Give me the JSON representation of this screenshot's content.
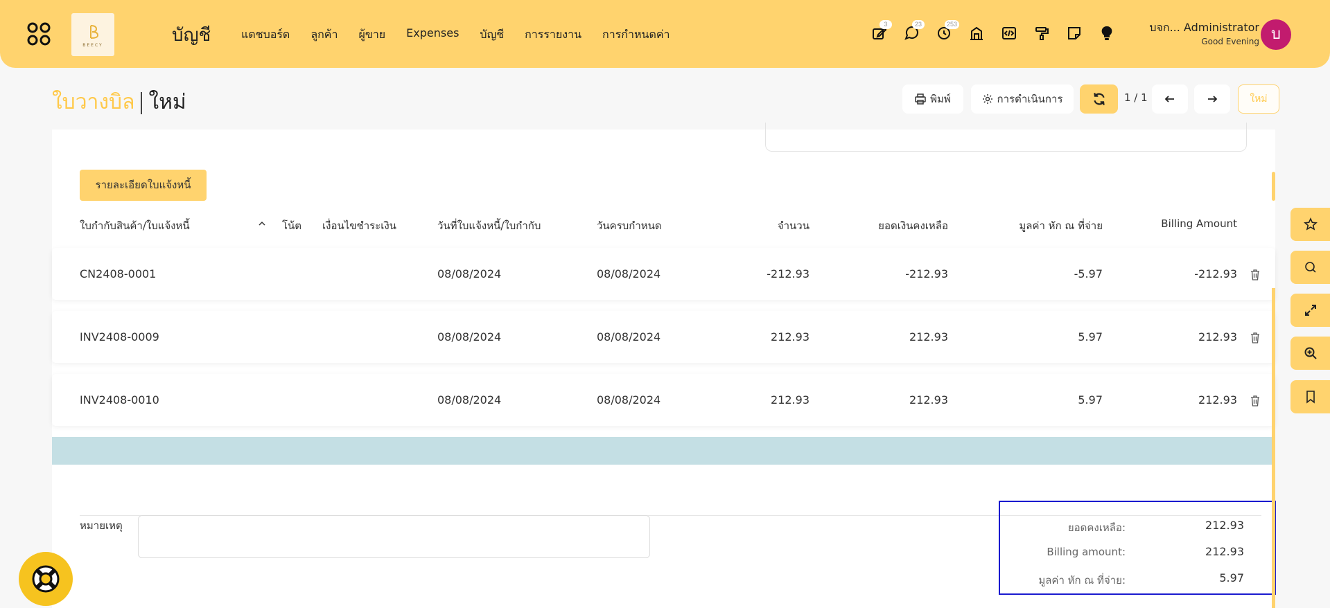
{
  "app": {
    "title": "บัญชี",
    "logo_text": "BEECY"
  },
  "nav": [
    "แดชบอร์ด",
    "ลูกค้า",
    "ผู้ขาย",
    "Expenses",
    "บัญชี",
    "การรายงาน",
    "การกำหนดค่า"
  ],
  "toolbar_icons": [
    {
      "icon": "edit-icon",
      "badge": "3"
    },
    {
      "icon": "chat-icon",
      "badge": "23"
    },
    {
      "icon": "clock-icon",
      "badge": "253"
    },
    {
      "icon": "building-icon",
      "badge": ""
    },
    {
      "icon": "code-icon",
      "badge": ""
    },
    {
      "icon": "paint-roller-icon",
      "badge": ""
    },
    {
      "icon": "sticky-note-icon",
      "badge": ""
    },
    {
      "icon": "lightbulb-icon",
      "badge": ""
    }
  ],
  "user": {
    "name": "บจก... Administrator",
    "greeting": "Good Evening",
    "avatar_letter": "บ"
  },
  "page": {
    "breadcrumb_parent": "ใบวางบิล",
    "breadcrumb_current": "ใหม่",
    "print_label": "พิมพ์",
    "actions_label": "การดำเนินการ",
    "pager": "1 / 1",
    "new_label": "ใหม่"
  },
  "section_button": "รายละเอียดใบแจ้งหนี้",
  "table": {
    "headers": [
      "ใบกำกับสินค้า/ใบแจ้งหนี้",
      "โน้ต",
      "เงื่อนไขชำระเงิน",
      "วันที่ใบแจ้งหนี้/ใบกำกับ",
      "วันครบกำหนด",
      "จำนวน",
      "ยอดเงินคงเหลือ",
      "มูลค่า หัก ณ ที่จ่าย",
      "Billing Amount"
    ],
    "rows": [
      {
        "doc": "CN2408-0001",
        "note": "",
        "terms": "",
        "invoice_date": "08/08/2024",
        "due_date": "08/08/2024",
        "amount": "-212.93",
        "balance": "-212.93",
        "withholding": "-5.97",
        "billing": "-212.93"
      },
      {
        "doc": "INV2408-0009",
        "note": "",
        "terms": "",
        "invoice_date": "08/08/2024",
        "due_date": "08/08/2024",
        "amount": "212.93",
        "balance": "212.93",
        "withholding": "5.97",
        "billing": "212.93"
      },
      {
        "doc": "INV2408-0010",
        "note": "",
        "terms": "",
        "invoice_date": "08/08/2024",
        "due_date": "08/08/2024",
        "amount": "212.93",
        "balance": "212.93",
        "withholding": "5.97",
        "billing": "212.93"
      }
    ]
  },
  "notes": {
    "label": "หมายเหตุ",
    "value": ""
  },
  "totals": [
    {
      "label": "ยอดคงเหลือ:",
      "value": "212.93"
    },
    {
      "label": "Billing amount:",
      "value": "212.93"
    },
    {
      "label": "มูลค่า หัก ณ ที่จ่าย:",
      "value": "5.97"
    }
  ],
  "side_tools": [
    "star-icon",
    "search-icon",
    "expand-icon",
    "zoom-in-icon",
    "bookmark-icon"
  ],
  "colors": {
    "accent": "#ffd36e",
    "crumb": "#ffc94a",
    "avatar": "#c21b6e",
    "band": "#c4dfe4",
    "highlight": "#1a1acf"
  }
}
